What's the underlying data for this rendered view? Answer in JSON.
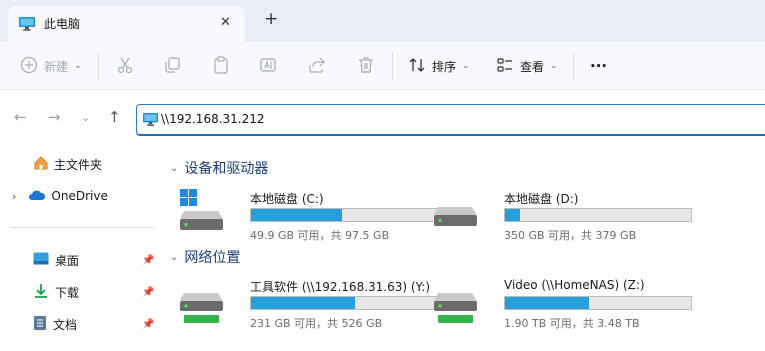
{
  "tab": {
    "title": "此电脑",
    "close_symbol": "✕"
  },
  "newtab_symbol": "+",
  "toolbar": {
    "new_label": "新建",
    "sort_label": "排序",
    "view_label": "查看",
    "more_symbol": "···"
  },
  "address": {
    "value": "\\\\192.168.31.212"
  },
  "sidebar": {
    "items": [
      {
        "label": "主文件夹",
        "icon": "home-icon"
      },
      {
        "label": "OneDrive",
        "icon": "cloud-icon"
      },
      {
        "label": "桌面",
        "icon": "desktop-icon"
      },
      {
        "label": "下载",
        "icon": "download-icon"
      },
      {
        "label": "文档",
        "icon": "document-icon"
      }
    ]
  },
  "sections": {
    "devices": "设备和驱动器",
    "network": "网络位置"
  },
  "drives": [
    {
      "name": "本地磁盘 (C:)",
      "free": "49.9 GB 可用，共 97.5 GB",
      "used_fraction": 0.49,
      "kind": "system"
    },
    {
      "name": "本地磁盘 (D:)",
      "free": "350 GB 可用，共 379 GB",
      "used_fraction": 0.08,
      "kind": "local"
    },
    {
      "name": "工具软件 (\\\\192.168.31.63) (Y:)",
      "free": "231 GB 可用，共 526 GB",
      "used_fraction": 0.56,
      "kind": "network"
    },
    {
      "name": "Video (\\\\HomeNAS) (Z:)",
      "free": "1.90 TB 可用，共 3.48 TB",
      "used_fraction": 0.45,
      "kind": "network"
    }
  ],
  "colors": {
    "accent": "#2b78c6",
    "bar_fill": "#26a0da",
    "section_text": "#1c3f7a"
  }
}
